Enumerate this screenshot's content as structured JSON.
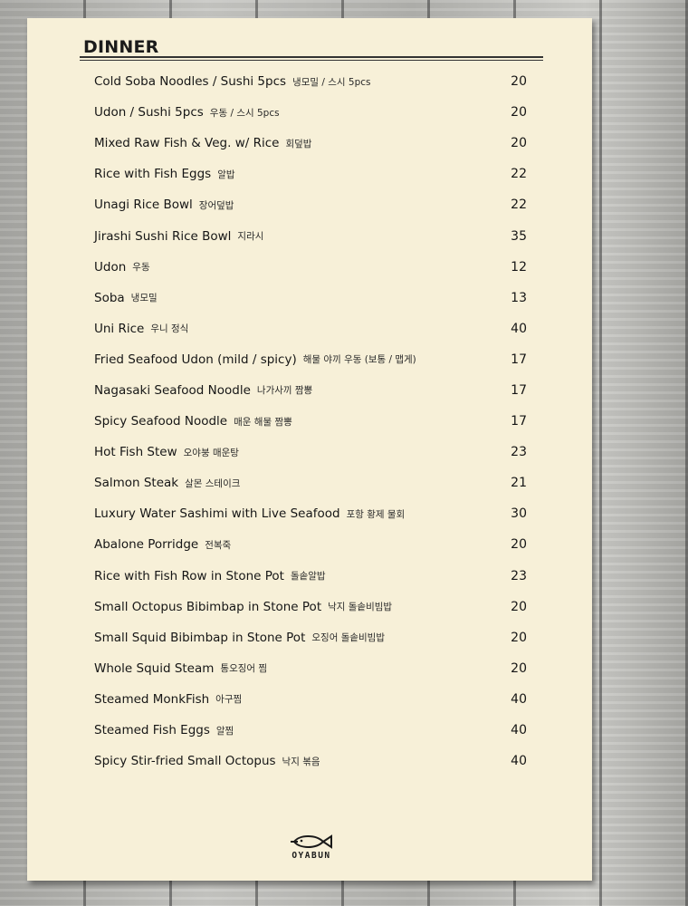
{
  "menu": {
    "title": "DINNER",
    "items": [
      {
        "name": "Cold Soba Noodles / Sushi 5pcs",
        "korean": "냉모밀 / 스시 5pcs",
        "price": "20"
      },
      {
        "name": "Udon / Sushi 5pcs",
        "korean": "우동 / 스시 5pcs",
        "price": "20"
      },
      {
        "name": "Mixed Raw Fish & Veg. w/ Rice",
        "korean": "회덮밥",
        "price": "20"
      },
      {
        "name": "Rice with Fish Eggs",
        "korean": "알밥",
        "price": "22"
      },
      {
        "name": "Unagi Rice Bowl",
        "korean": "장어덮밥",
        "price": "22"
      },
      {
        "name": "Jirashi Sushi Rice Bowl",
        "korean": "지라시",
        "price": "35"
      },
      {
        "name": "Udon",
        "korean": "우동",
        "price": "12"
      },
      {
        "name": "Soba",
        "korean": "냉모밀",
        "price": "13"
      },
      {
        "name": "Uni Rice",
        "korean": "우니 정식",
        "price": "40"
      },
      {
        "name": "Fried Seafood Udon (mild / spicy)",
        "korean": "해물 야끼 우동 (보통 / 맵게)",
        "price": "17"
      },
      {
        "name": "Nagasaki Seafood Noodle",
        "korean": "나가사끼 짬뽕",
        "price": "17"
      },
      {
        "name": "Spicy Seafood Noodle",
        "korean": "매운 해물 짬뽕",
        "price": "17"
      },
      {
        "name": "Hot Fish Stew",
        "korean": "오야붕 매운탕",
        "price": "23"
      },
      {
        "name": "Salmon Steak",
        "korean": "살몬 스테이크",
        "price": "21"
      },
      {
        "name": "Luxury Water Sashimi with Live Seafood",
        "korean": "포항 황제 물회",
        "price": "30"
      },
      {
        "name": "Abalone Porridge",
        "korean": "전복죽",
        "price": "20"
      },
      {
        "name": "Rice with Fish Row in Stone Pot",
        "korean": "돌솥알밥",
        "price": "23"
      },
      {
        "name": "Small Octopus Bibimbap in Stone Pot",
        "korean": "낙지 돌솥비빔밥",
        "price": "20"
      },
      {
        "name": "Small Squid Bibimbap in Stone Pot",
        "korean": "오징어 돌솥비빔밥",
        "price": "20"
      },
      {
        "name": "Whole Squid Steam",
        "korean": "통오징어 찜",
        "price": "20"
      },
      {
        "name": "Steamed MonkFish",
        "korean": "아구찜",
        "price": "40"
      },
      {
        "name": "Steamed Fish Eggs",
        "korean": "알찜",
        "price": "40"
      },
      {
        "name": "Spicy Stir-fried Small Octopus",
        "korean": "낙지 볶음",
        "price": "40"
      }
    ]
  },
  "logo": {
    "text": "OYABUN",
    "icon": "fish-icon"
  },
  "colors": {
    "paper": "#f7f0d8",
    "ink": "#161616",
    "wood": "#b8b8b4"
  }
}
